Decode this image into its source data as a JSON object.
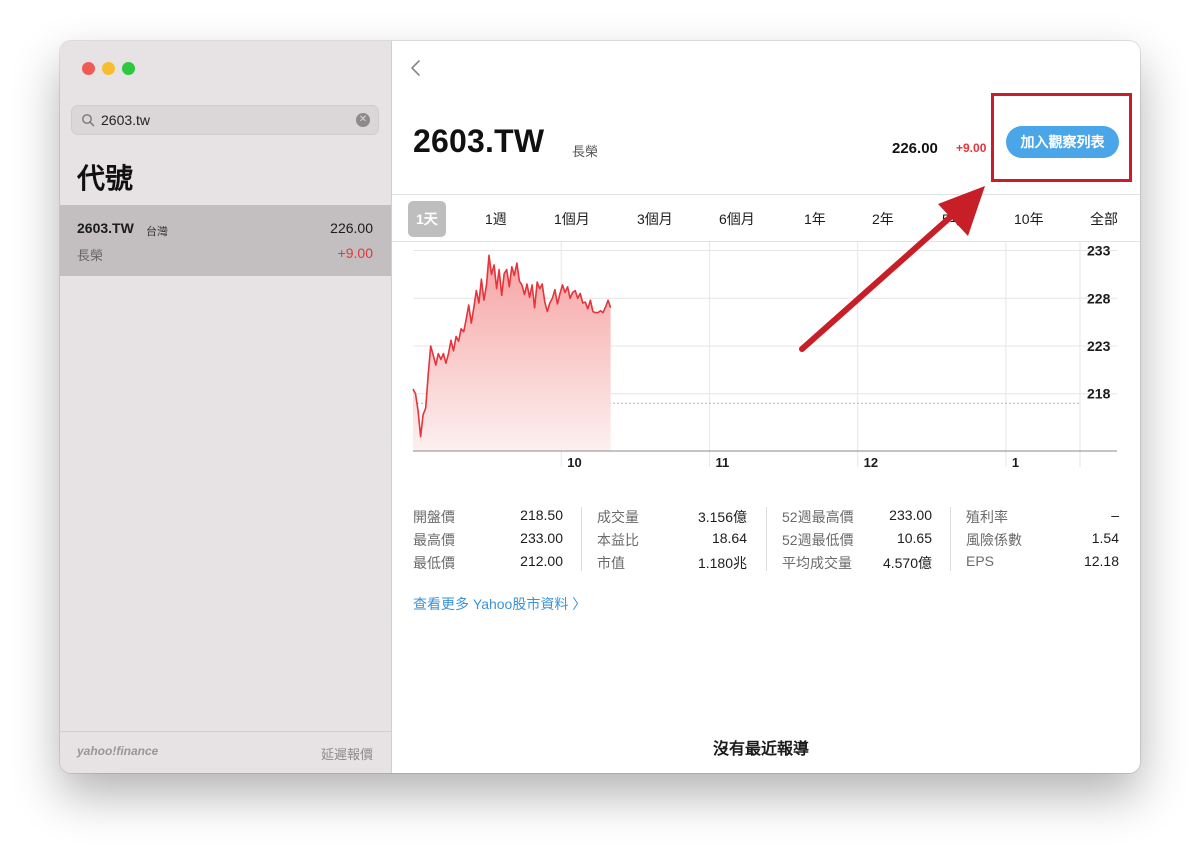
{
  "search": {
    "value": "2603.tw",
    "clear_icon": "clear-icon",
    "icon": "search-icon"
  },
  "sidebar": {
    "heading": "代號",
    "result": {
      "symbol": "2603.TW",
      "market": "台灣",
      "name": "長榮",
      "price": "226.00",
      "change": "+9.00"
    },
    "footer": {
      "logo": "yahoo!finance",
      "delay": "延遲報價"
    }
  },
  "header": {
    "ticker": "2603.TW",
    "company": "長榮",
    "price": "226.00",
    "change": "+9.00",
    "watch_button": "加入觀察列表"
  },
  "ranges": [
    "1天",
    "1週",
    "1個月",
    "3個月",
    "6個月",
    "1年",
    "2年",
    "5年",
    "10年",
    "全部"
  ],
  "active_range": "1天",
  "chart_data": {
    "type": "area",
    "x_labels": [
      "10",
      "11",
      "12",
      "1"
    ],
    "y_ticks": [
      233,
      228,
      223,
      218
    ],
    "ylim": [
      212,
      234
    ],
    "reference_line": 217,
    "series": [
      {
        "values": [
          218.5,
          218.0,
          216.2,
          213.5,
          215.8,
          216.5,
          220.0,
          223.0,
          222.0,
          221.0,
          222.2,
          221.6,
          222.2,
          221.2,
          222.2,
          223.6,
          222.5,
          224.0,
          223.5,
          224.8,
          224.5,
          225.8,
          227.3,
          225.4,
          227.0,
          228.8,
          227.5,
          230.0,
          227.8,
          229.4,
          232.5,
          230.5,
          231.5,
          229.0,
          231.0,
          228.3,
          230.6,
          231.0,
          229.2,
          231.3,
          230.4,
          231.7,
          229.8,
          229.4,
          228.4,
          229.5,
          228.1,
          229.4,
          227.0,
          229.7,
          229.0,
          229.5,
          227.6,
          226.6,
          227.5,
          228.0,
          228.9,
          227.4,
          228.5,
          229.4,
          228.6,
          229.2,
          228.0,
          228.6,
          228.8,
          228.0,
          228.5,
          227.5,
          227.6,
          226.9,
          227.8,
          226.6,
          226.5,
          226.5,
          226.7,
          226.5,
          227.1,
          227.8,
          227.0
        ]
      }
    ],
    "colors": {
      "line": "#e5343b",
      "fill_top": "#f6a3a3",
      "fill_bottom": "#fdf0f0"
    },
    "grid": true
  },
  "stats": [
    [
      {
        "label": "開盤價",
        "value": "218.50"
      },
      {
        "label": "最高價",
        "value": "233.00"
      },
      {
        "label": "最低價",
        "value": "212.00"
      }
    ],
    [
      {
        "label": "成交量",
        "value": "3.156億"
      },
      {
        "label": "本益比",
        "value": "18.64"
      },
      {
        "label": "市值",
        "value": "1.180兆"
      }
    ],
    [
      {
        "label": "52週最高價",
        "value": "233.00"
      },
      {
        "label": "52週最低價",
        "value": "10.65"
      },
      {
        "label": "平均成交量",
        "value": "4.570億"
      }
    ],
    [
      {
        "label": "殖利率",
        "value": "–"
      },
      {
        "label": "風險係數",
        "value": "1.54"
      },
      {
        "label": "EPS",
        "value": "12.18"
      }
    ]
  ],
  "more_link": "查看更多 Yahoo股市資料 〉",
  "no_news": "沒有最近報導",
  "colors": {
    "up": "#e5343b",
    "accent": "#4aa6e8",
    "annotation": "#c81e28"
  }
}
